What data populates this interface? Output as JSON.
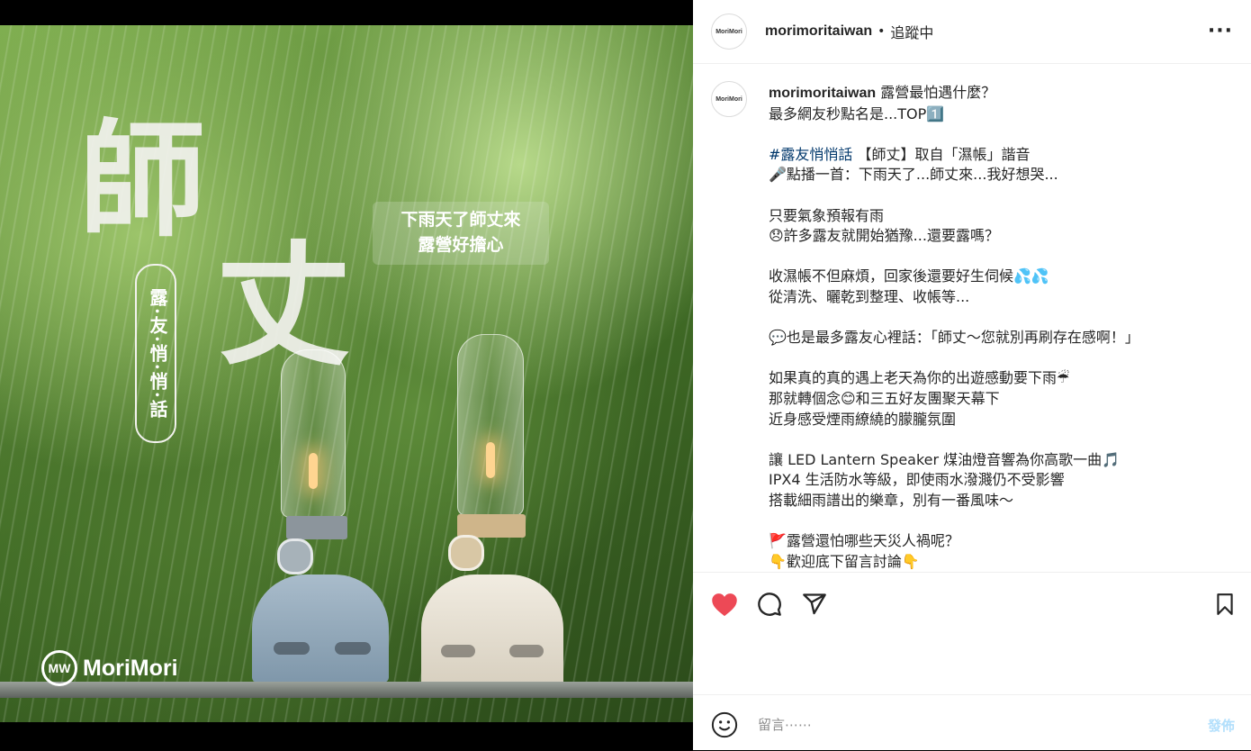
{
  "post": {
    "image": {
      "headline_char_1": "師",
      "headline_char_2": "丈",
      "vertical_label": "露·友·悄·悄·話",
      "caption_box_line1": "下雨天了師丈來",
      "caption_box_line2": "露營好擔心",
      "brand": "MoriMori"
    },
    "header": {
      "avatar_text": "MoriMori",
      "username": "morimoritaiwan",
      "separator": "•",
      "follow_status": "追蹤中",
      "more": "···"
    },
    "caption": {
      "username": "morimoritaiwan",
      "first_line": " 露營最怕遇什麼？",
      "line2": "最多網友秒點名是...TOP1️⃣",
      "hashtag": "#露友悄悄話",
      "after_hashtag": " 【師丈】取自「濕帳」諧音",
      "body": "🎤點播一首：下雨天了...師丈來...我好想哭...\n\n只要氣象預報有雨\n😞許多露友就開始猶豫...還要露嗎？\n\n收濕帳不但麻煩，回家後還要好生伺候💦💦\n從清洗、曬乾到整理、收帳等...\n\n💬也是最多露友心裡話：「師丈～您就別再刷存在感啊！」\n\n如果真的真的遇上老天為你的出遊感動要下雨☔\n那就轉個念😊和三五好友團聚天幕下\n近身感受煙雨繚繞的朦朧氛圍\n\n讓 LED Lantern Speaker 煤油燈音響為你高歌一曲🎵\nIPX4 生活防水等級，即使雨水潑濺仍不受影響\n搭載細雨譜出的樂章，別有一番風味～\n\n🚩露營還怕哪些天災人禍呢？\n👇歡迎底下留言討論👇"
    },
    "comment_box": {
      "placeholder": "留言⋯⋯",
      "post_label": "發佈"
    },
    "colors": {
      "like_red": "#ed4956",
      "post_button_disabled": "#b2dffc",
      "hashtag_blue": "#00376b"
    },
    "icons": [
      "heart-icon",
      "comment-icon",
      "share-icon",
      "bookmark-icon",
      "emoji-icon"
    ],
    "liked": true
  }
}
